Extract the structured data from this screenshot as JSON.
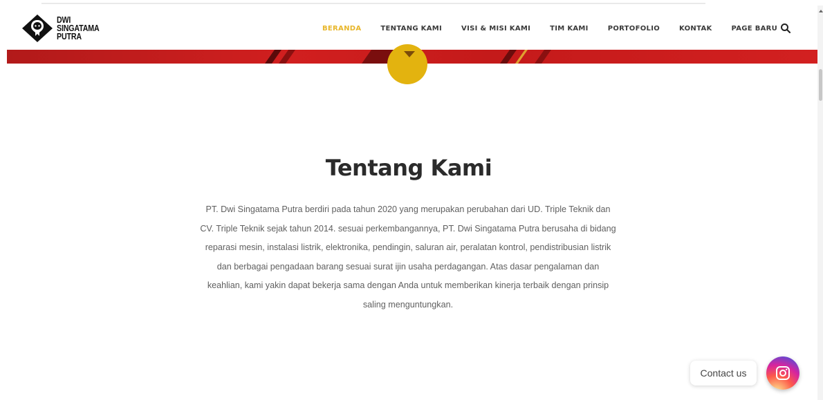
{
  "brand": {
    "line1": "DWI",
    "line2": "SINGATAMA",
    "line3": "PUTRA"
  },
  "nav": {
    "items": [
      {
        "label": "BERANDA",
        "active": true
      },
      {
        "label": "TENTANG KAMI"
      },
      {
        "label": "VISI & MISI KAMI"
      },
      {
        "label": "TIM KAMI"
      },
      {
        "label": "PORTOFOLIO"
      },
      {
        "label": "KONTAK"
      },
      {
        "label": "PAGE BARU"
      }
    ],
    "search_icon": "search-icon"
  },
  "colors": {
    "accent": "#e8b62a",
    "banner_red": "#c41a1a",
    "circle_gold": "#e3b30f"
  },
  "section": {
    "title": "Tentang Kami",
    "lines": [
      "PT. Dwi Singatama Putra berdiri pada tahun 2020 yang merupakan perubahan dari UD. Triple Teknik dan",
      "CV. Triple Teknik sejak tahun 2014. sesuai perkembangannya, PT. Dwi Singatama Putra berusaha di bidang",
      "reparasi mesin, instalasi listrik, elektronika, pendingin, saluran air, peralatan kontrol, pendistribusian listrik",
      "dan berbagai pengadaan barang sesuai surat ijin usaha perdagangan. Atas dasar pengalaman dan",
      "keahlian, kami yakin dapat bekerja sama dengan Anda untuk memberikan kinerja terbaik dengan prinsip",
      "saling menguntungkan."
    ]
  },
  "widget": {
    "contact_label": "Contact us",
    "instagram_icon": "instagram-icon"
  }
}
